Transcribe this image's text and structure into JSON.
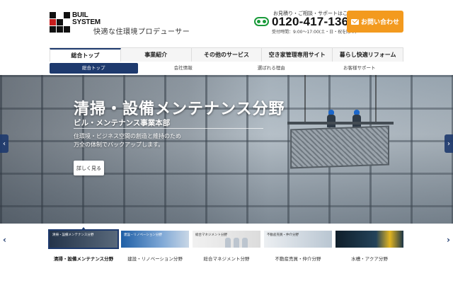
{
  "header": {
    "logo": {
      "line1": "BUIL",
      "line2": "SYSTEM"
    },
    "tagline": "快適な住環境プロデューサー",
    "contact_caption": "お見積り・ご相談・サポートはこちら",
    "phone": "0120-417-136",
    "hours": "受付時間：9:00～17:00(土・日・祝を除く)",
    "contact_button": "お問い合わせ",
    "colors": {
      "accent": "#f39a1e",
      "navy": "#1e3a6e",
      "dial_green": "#1a9a3a",
      "logo_red": "#c81e1e"
    }
  },
  "nav": {
    "items": [
      {
        "label": "総合トップ",
        "active": true
      },
      {
        "label": "事業紹介"
      },
      {
        "label": "その他のサービス"
      },
      {
        "label": "空き家管理専用サイト"
      },
      {
        "label": "暮らし快適リフォーム"
      }
    ],
    "sub_items": [
      {
        "label": "総合トップ",
        "active": true
      },
      {
        "label": "会社情報"
      },
      {
        "label": "選ばれる理由"
      },
      {
        "label": "お客様サポート"
      }
    ]
  },
  "hero": {
    "title": "清掃・設備メンテナンス分野",
    "subtitle": "ビル・メンテナンス事業本部",
    "description": [
      "住環境・ビジネス空間の創造と維持のため",
      "万全の体制でバックアップします。"
    ],
    "more_button": "詳しく見る",
    "prev_icon": "chevron-left-icon",
    "next_icon": "chevron-right-icon"
  },
  "thumbnails": [
    {
      "label": "清掃・設備メンテナンス分野",
      "caption": "清掃・設備メンテナンス分野",
      "active": true
    },
    {
      "label": "建設・リノベーション分野",
      "caption": "建設・リノベーション分野"
    },
    {
      "label": "総合マネジメント分野",
      "caption": "総合マネジメント分野"
    },
    {
      "label": "不動産売買・仲介分野",
      "caption": "不動産売買・仲介分野"
    },
    {
      "label": "水槽・アクア分野",
      "caption": ""
    }
  ]
}
